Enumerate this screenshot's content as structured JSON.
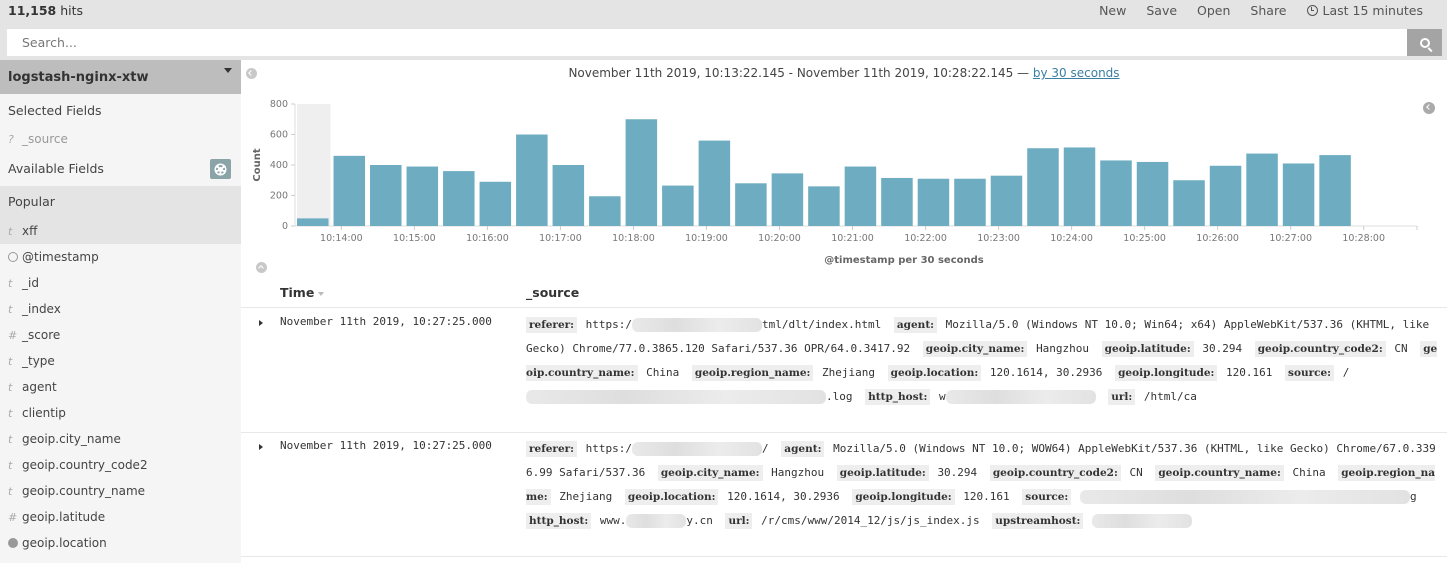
{
  "topbar": {
    "hits_count": "11,158",
    "hits_label": "hits",
    "nav": [
      "New",
      "Save",
      "Open",
      "Share"
    ],
    "time_picker": "Last 15 minutes"
  },
  "search": {
    "placeholder": "Search...",
    "value": ""
  },
  "sidebar": {
    "index_pattern": "logstash-nginx-xtw",
    "selected_title": "Selected Fields",
    "selected_fields": [
      {
        "type": "?",
        "name": "_source"
      }
    ],
    "available_title": "Available Fields",
    "popular_title": "Popular",
    "popular_fields": [
      {
        "type": "t",
        "name": "xff"
      }
    ],
    "fields": [
      {
        "type": "clock",
        "name": "@timestamp"
      },
      {
        "type": "t",
        "name": "_id"
      },
      {
        "type": "t",
        "name": "_index"
      },
      {
        "type": "#",
        "name": "_score"
      },
      {
        "type": "t",
        "name": "_type"
      },
      {
        "type": "t",
        "name": "agent"
      },
      {
        "type": "t",
        "name": "clientip"
      },
      {
        "type": "t",
        "name": "geoip.city_name"
      },
      {
        "type": "t",
        "name": "geoip.country_code2"
      },
      {
        "type": "t",
        "name": "geoip.country_name"
      },
      {
        "type": "#",
        "name": "geoip.latitude"
      },
      {
        "type": "globe",
        "name": "geoip.location"
      }
    ]
  },
  "main": {
    "time_range": "November 11th 2019, 10:13:22.145 - November 11th 2019, 10:28:22.145 —",
    "interval_link": "by 30 seconds",
    "table": {
      "col_time": "Time",
      "col_source": "_source",
      "rows": [
        {
          "time": "November 11th 2019, 10:27:25.000",
          "source": [
            {
              "k": "referer:",
              "v": "https:/",
              "blur": 130,
              "v2": "tml/dlt/index.html"
            },
            {
              "k": "agent:",
              "v": "Mozilla/5.0 (Windows NT 10.0; Win64; x64) AppleWebKit/537.36 (KHTML, like Gecko) Chrome/77.0.3865.120 Safari/537.36 OPR/64.0.3417.92"
            },
            {
              "k": "geoip.city_name:",
              "v": "Hangzhou"
            },
            {
              "k": "geoip.latitude:",
              "v": "30.294"
            },
            {
              "k": "geoip.country_code2:",
              "v": "CN"
            },
            {
              "k": "geoip.country_name:",
              "v": "China"
            },
            {
              "k": "geoip.region_name:",
              "v": "Zhejiang"
            },
            {
              "k": "geoip.location:",
              "v": "120.1614, 30.2936"
            },
            {
              "k": "geoip.longitude:",
              "v": "120.161"
            },
            {
              "k": "source:",
              "v": "/",
              "blur": 300,
              "v2": ".log"
            },
            {
              "k": "http_host:",
              "v": "w",
              "blur": 150,
              "v2": ""
            },
            {
              "k": "url:",
              "v": "/html/ca"
            }
          ]
        },
        {
          "time": "November 11th 2019, 10:27:25.000",
          "source": [
            {
              "k": "referer:",
              "v": "https:/",
              "blur": 130,
              "v2": "/"
            },
            {
              "k": "agent:",
              "v": "Mozilla/5.0 (Windows NT 10.0; WOW64) AppleWebKit/537.36 (KHTML, like Gecko) Chrome/67.0.3396.99 Safari/537.36"
            },
            {
              "k": "geoip.city_name:",
              "v": "Hangzhou"
            },
            {
              "k": "geoip.latitude:",
              "v": "30.294"
            },
            {
              "k": "geoip.country_code2:",
              "v": "CN"
            },
            {
              "k": "geoip.country_name:",
              "v": "China"
            },
            {
              "k": "geoip.region_name:",
              "v": "Zhejiang"
            },
            {
              "k": "geoip.location:",
              "v": "120.1614, 30.2936"
            },
            {
              "k": "geoip.longitude:",
              "v": "120.161"
            },
            {
              "k": "source:",
              "v": "",
              "blur": 330,
              "v2": "g"
            },
            {
              "k": "http_host:",
              "v": "www.",
              "blur": 60,
              "v2": "y.cn"
            },
            {
              "k": "url:",
              "v": "/r/cms/www/2014_12/js/js_index.js"
            },
            {
              "k": "upstreamhost:",
              "v": "",
              "blur": 100,
              "v2": ""
            }
          ]
        }
      ]
    }
  },
  "colors": {
    "bar": "#6eadc1",
    "link": "#3a7ea1",
    "topbar": "#e4e4e4",
    "sidebar": "#f5f5f5"
  },
  "chart_data": {
    "type": "bar",
    "title": "",
    "xlabel": "@timestamp per 30 seconds",
    "ylabel": "Count",
    "ylim": [
      0,
      800
    ],
    "yticks": [
      0,
      200,
      400,
      600,
      800
    ],
    "xticks": [
      "10:14:00",
      "10:15:00",
      "10:16:00",
      "10:17:00",
      "10:18:00",
      "10:19:00",
      "10:20:00",
      "10:21:00",
      "10:22:00",
      "10:23:00",
      "10:24:00",
      "10:25:00",
      "10:26:00",
      "10:27:00",
      "10:28:00"
    ],
    "categories": [
      "10:13:00",
      "10:13:30",
      "10:14:00",
      "10:14:30",
      "10:15:00",
      "10:15:30",
      "10:16:00",
      "10:16:30",
      "10:17:00",
      "10:17:30",
      "10:18:00",
      "10:18:30",
      "10:19:00",
      "10:19:30",
      "10:20:00",
      "10:20:30",
      "10:21:00",
      "10:21:30",
      "10:22:00",
      "10:22:30",
      "10:23:00",
      "10:23:30",
      "10:24:00",
      "10:24:30",
      "10:25:00",
      "10:25:30",
      "10:26:00",
      "10:26:30",
      "10:27:00"
    ],
    "values": [
      50,
      460,
      400,
      390,
      360,
      290,
      600,
      400,
      195,
      700,
      265,
      560,
      280,
      345,
      260,
      390,
      315,
      310,
      310,
      330,
      510,
      515,
      430,
      420,
      300,
      395,
      475,
      410,
      465
    ],
    "partial_bucket_shaded": "first",
    "grid": false,
    "legend": "none"
  }
}
